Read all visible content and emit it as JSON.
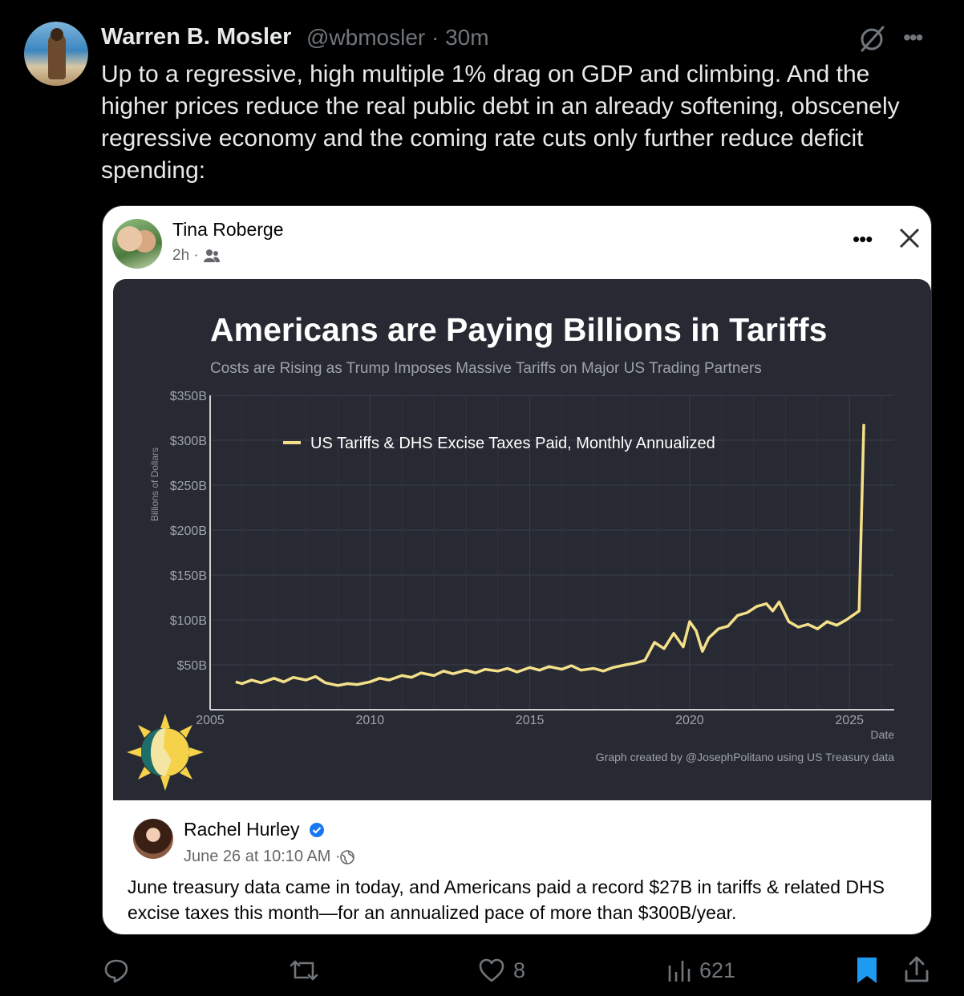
{
  "tweet": {
    "author_name": "Warren B. Mosler",
    "author_meta": "@wbmosler · 30m",
    "text": "Up to a regressive, high multiple 1% drag on GDP and climbing. And the higher prices reduce the real public debt in an already softening, obscenely regressive economy and the coming rate cuts only further reduce deficit spending:",
    "icons": [
      "grok-icon",
      "more-icon"
    ]
  },
  "embedded_post": {
    "author": "Tina Roberge",
    "time": "2h ·",
    "icons": [
      "people-icon",
      "more-icon",
      "close-icon"
    ]
  },
  "quoted_post": {
    "author": "Rachel Hurley",
    "time": "June 26 at 10:10 AM ·",
    "text": "June treasury data came in today, and Americans paid a record $27B in tariffs & related DHS excise taxes this month—for an annualized pace of more than $300B/year.",
    "icons": [
      "verified-icon",
      "globe-icon"
    ]
  },
  "actions": {
    "reply": "",
    "retweet": "",
    "likes": "8",
    "views": "621"
  },
  "colors": {
    "line": "#f5e08a",
    "panel": "#272a33",
    "bookmark": "#1d9bf0"
  },
  "chart_data": {
    "type": "line",
    "title": "Americans are Paying Billions in Tariffs",
    "subtitle": "Costs are Rising as Trump Imposes Massive Tariffs on Major US Trading Partners",
    "ylabel": "Billions of Dollars",
    "xlabel": "Date",
    "source": "Graph created by @JosephPolitano using US Treasury data",
    "ylim": [
      0,
      350
    ],
    "xlim": [
      2005,
      2026.4
    ],
    "x_ticks": [
      "2005",
      "2010",
      "2015",
      "2020",
      "2025"
    ],
    "y_ticks": [
      "$50B",
      "$100B",
      "$150B",
      "$200B",
      "$250B",
      "$300B",
      "$350B"
    ],
    "grid": true,
    "legend_position": "top-left",
    "series": [
      {
        "name": "US Tariffs & DHS Excise Taxes Paid, Monthly Annualized",
        "x": [
          2005.8,
          2006.0,
          2006.3,
          2006.6,
          2007.0,
          2007.3,
          2007.6,
          2008.0,
          2008.3,
          2008.6,
          2009.0,
          2009.3,
          2009.6,
          2010.0,
          2010.3,
          2010.6,
          2011.0,
          2011.3,
          2011.6,
          2012.0,
          2012.3,
          2012.6,
          2013.0,
          2013.3,
          2013.6,
          2014.0,
          2014.3,
          2014.6,
          2015.0,
          2015.3,
          2015.6,
          2016.0,
          2016.3,
          2016.6,
          2017.0,
          2017.3,
          2017.6,
          2018.0,
          2018.3,
          2018.6,
          2018.9,
          2019.2,
          2019.5,
          2019.8,
          2020.0,
          2020.2,
          2020.4,
          2020.6,
          2020.9,
          2021.2,
          2021.5,
          2021.8,
          2022.1,
          2022.4,
          2022.6,
          2022.8,
          2023.1,
          2023.4,
          2023.7,
          2024.0,
          2024.3,
          2024.6,
          2024.9,
          2025.1,
          2025.3,
          2025.45
        ],
        "values": [
          31,
          29,
          33,
          30,
          35,
          31,
          36,
          33,
          37,
          30,
          27,
          29,
          28,
          31,
          35,
          33,
          38,
          36,
          41,
          38,
          43,
          40,
          44,
          41,
          45,
          43,
          46,
          42,
          47,
          44,
          48,
          45,
          49,
          44,
          46,
          43,
          47,
          50,
          52,
          55,
          75,
          68,
          85,
          70,
          98,
          88,
          65,
          80,
          90,
          93,
          105,
          108,
          115,
          118,
          110,
          120,
          98,
          92,
          95,
          90,
          98,
          94,
          100,
          105,
          110,
          318
        ]
      }
    ]
  }
}
